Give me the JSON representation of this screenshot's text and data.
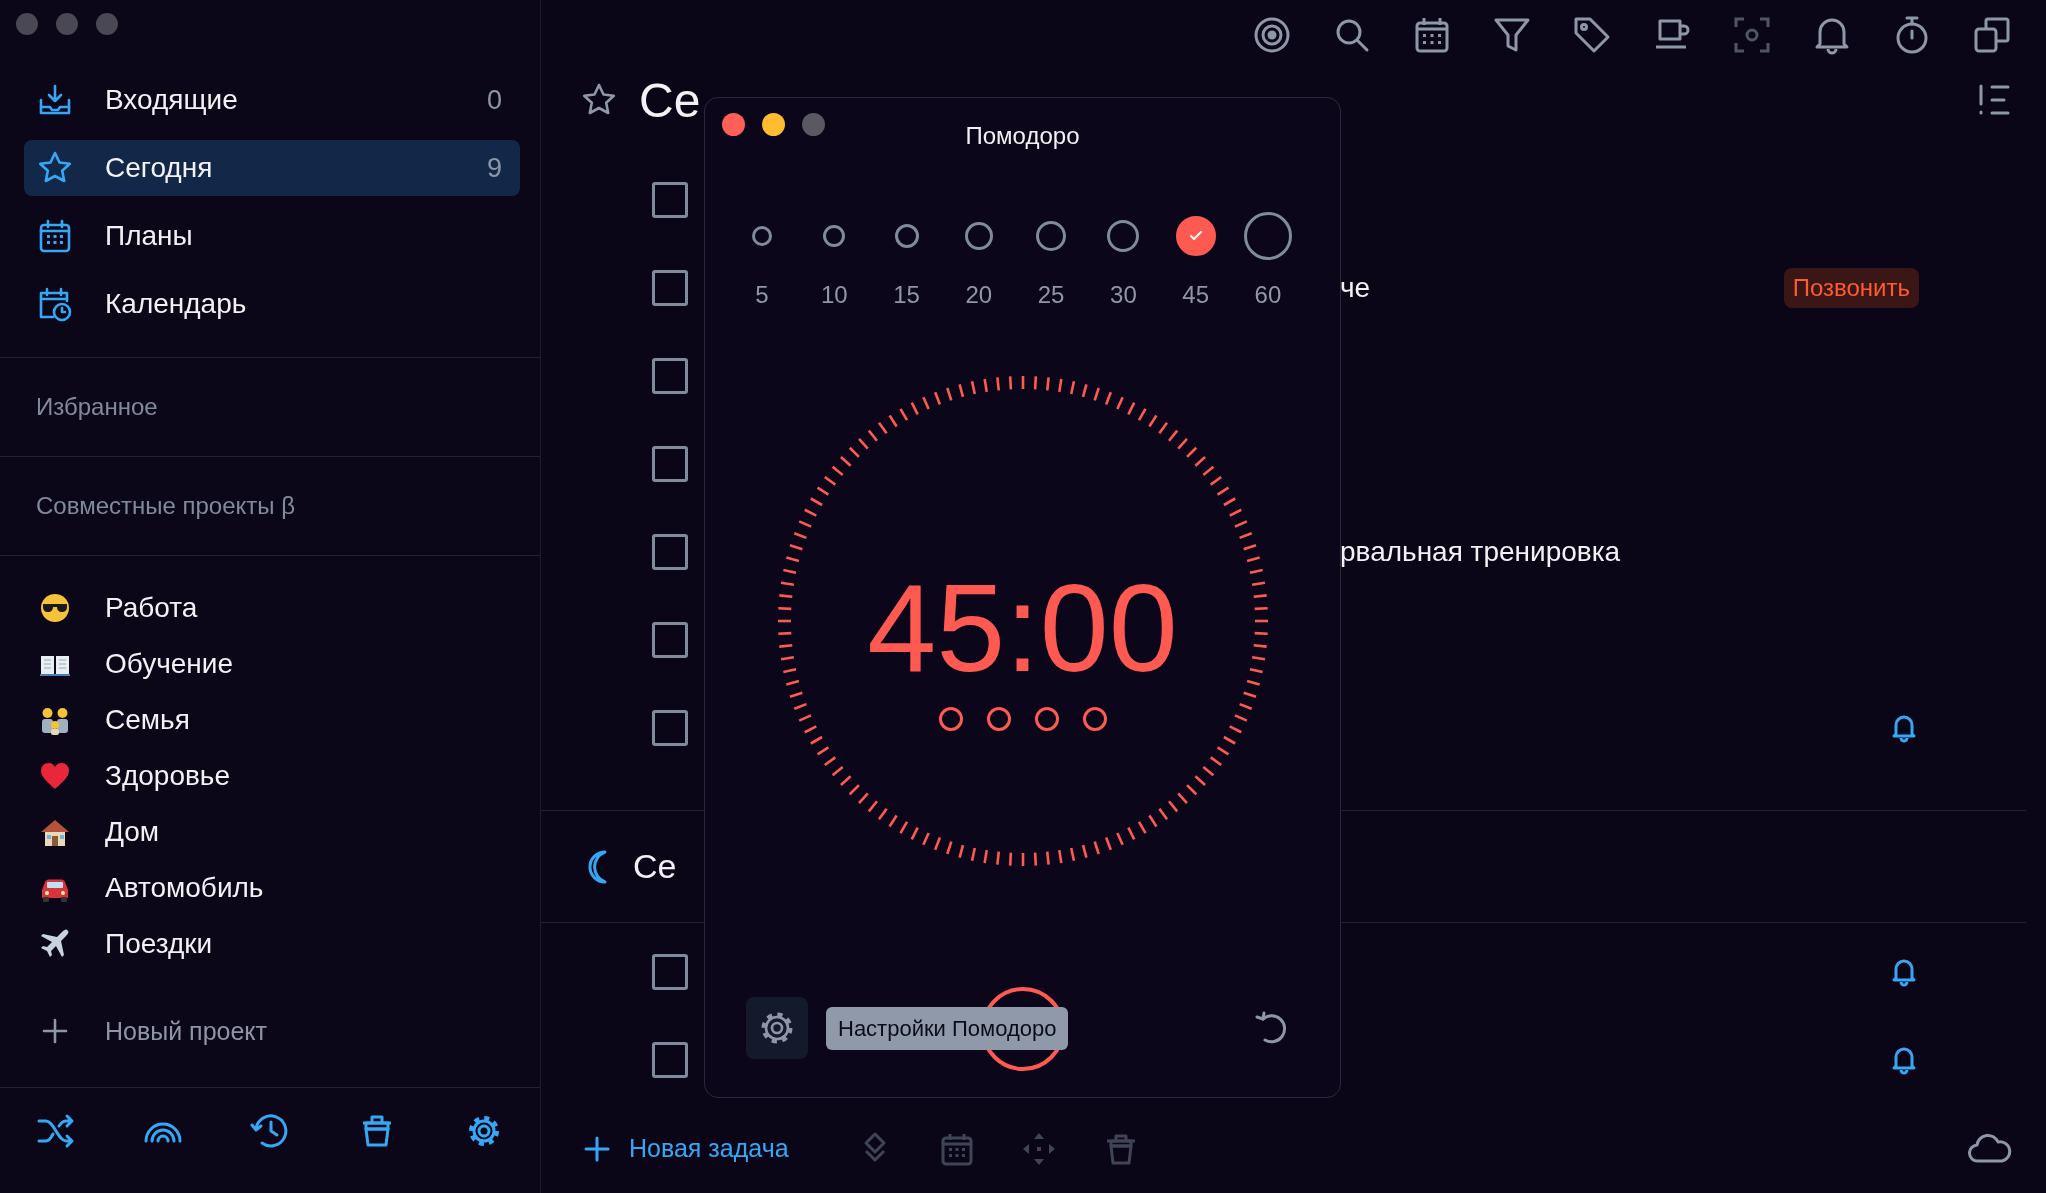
{
  "sidebar": {
    "nav": [
      {
        "label": "Входящие",
        "count": "0",
        "selected": false
      },
      {
        "label": "Сегодня",
        "count": "9",
        "selected": true
      },
      {
        "label": "Планы",
        "selected": false
      },
      {
        "label": "Календарь",
        "selected": false
      }
    ],
    "sections": [
      "Избранное",
      "Совместные проекты β"
    ],
    "projects": [
      {
        "label": "Работа"
      },
      {
        "label": "Обучение"
      },
      {
        "label": "Семья"
      },
      {
        "label": "Здоровье"
      },
      {
        "label": "Дом"
      },
      {
        "label": "Автомобиль"
      },
      {
        "label": "Поездки"
      }
    ],
    "new_project": "Новый проект"
  },
  "header": {
    "title": "Се"
  },
  "tasks": [
    {
      "checked": false
    },
    {
      "checked": false,
      "text": "че",
      "tag": "Позвонить"
    },
    {
      "checked": false
    },
    {
      "checked": false
    },
    {
      "checked": false,
      "text": "рвальная тренировка"
    },
    {
      "checked": false
    },
    {
      "checked": false,
      "reminder": true
    }
  ],
  "evening": {
    "title": "Се",
    "tasks": [
      {
        "checked": false,
        "reminder": true
      },
      {
        "checked": false,
        "reminder": true
      }
    ]
  },
  "bottom_bar": {
    "new_task": "Новая задача"
  },
  "pomodoro": {
    "title": "Помодоро",
    "durations": [
      {
        "label": "5",
        "selected": false
      },
      {
        "label": "10",
        "selected": false
      },
      {
        "label": "15",
        "selected": false
      },
      {
        "label": "20",
        "selected": false
      },
      {
        "label": "25",
        "selected": false
      },
      {
        "label": "30",
        "selected": false
      },
      {
        "label": "45",
        "selected": true
      },
      {
        "label": "60",
        "selected": false
      }
    ],
    "time": "45:00",
    "rounds": [
      {
        "done": false
      },
      {
        "done": false
      },
      {
        "done": false
      },
      {
        "done": false
      }
    ],
    "tooltip": "Настройки Помодоро"
  }
}
